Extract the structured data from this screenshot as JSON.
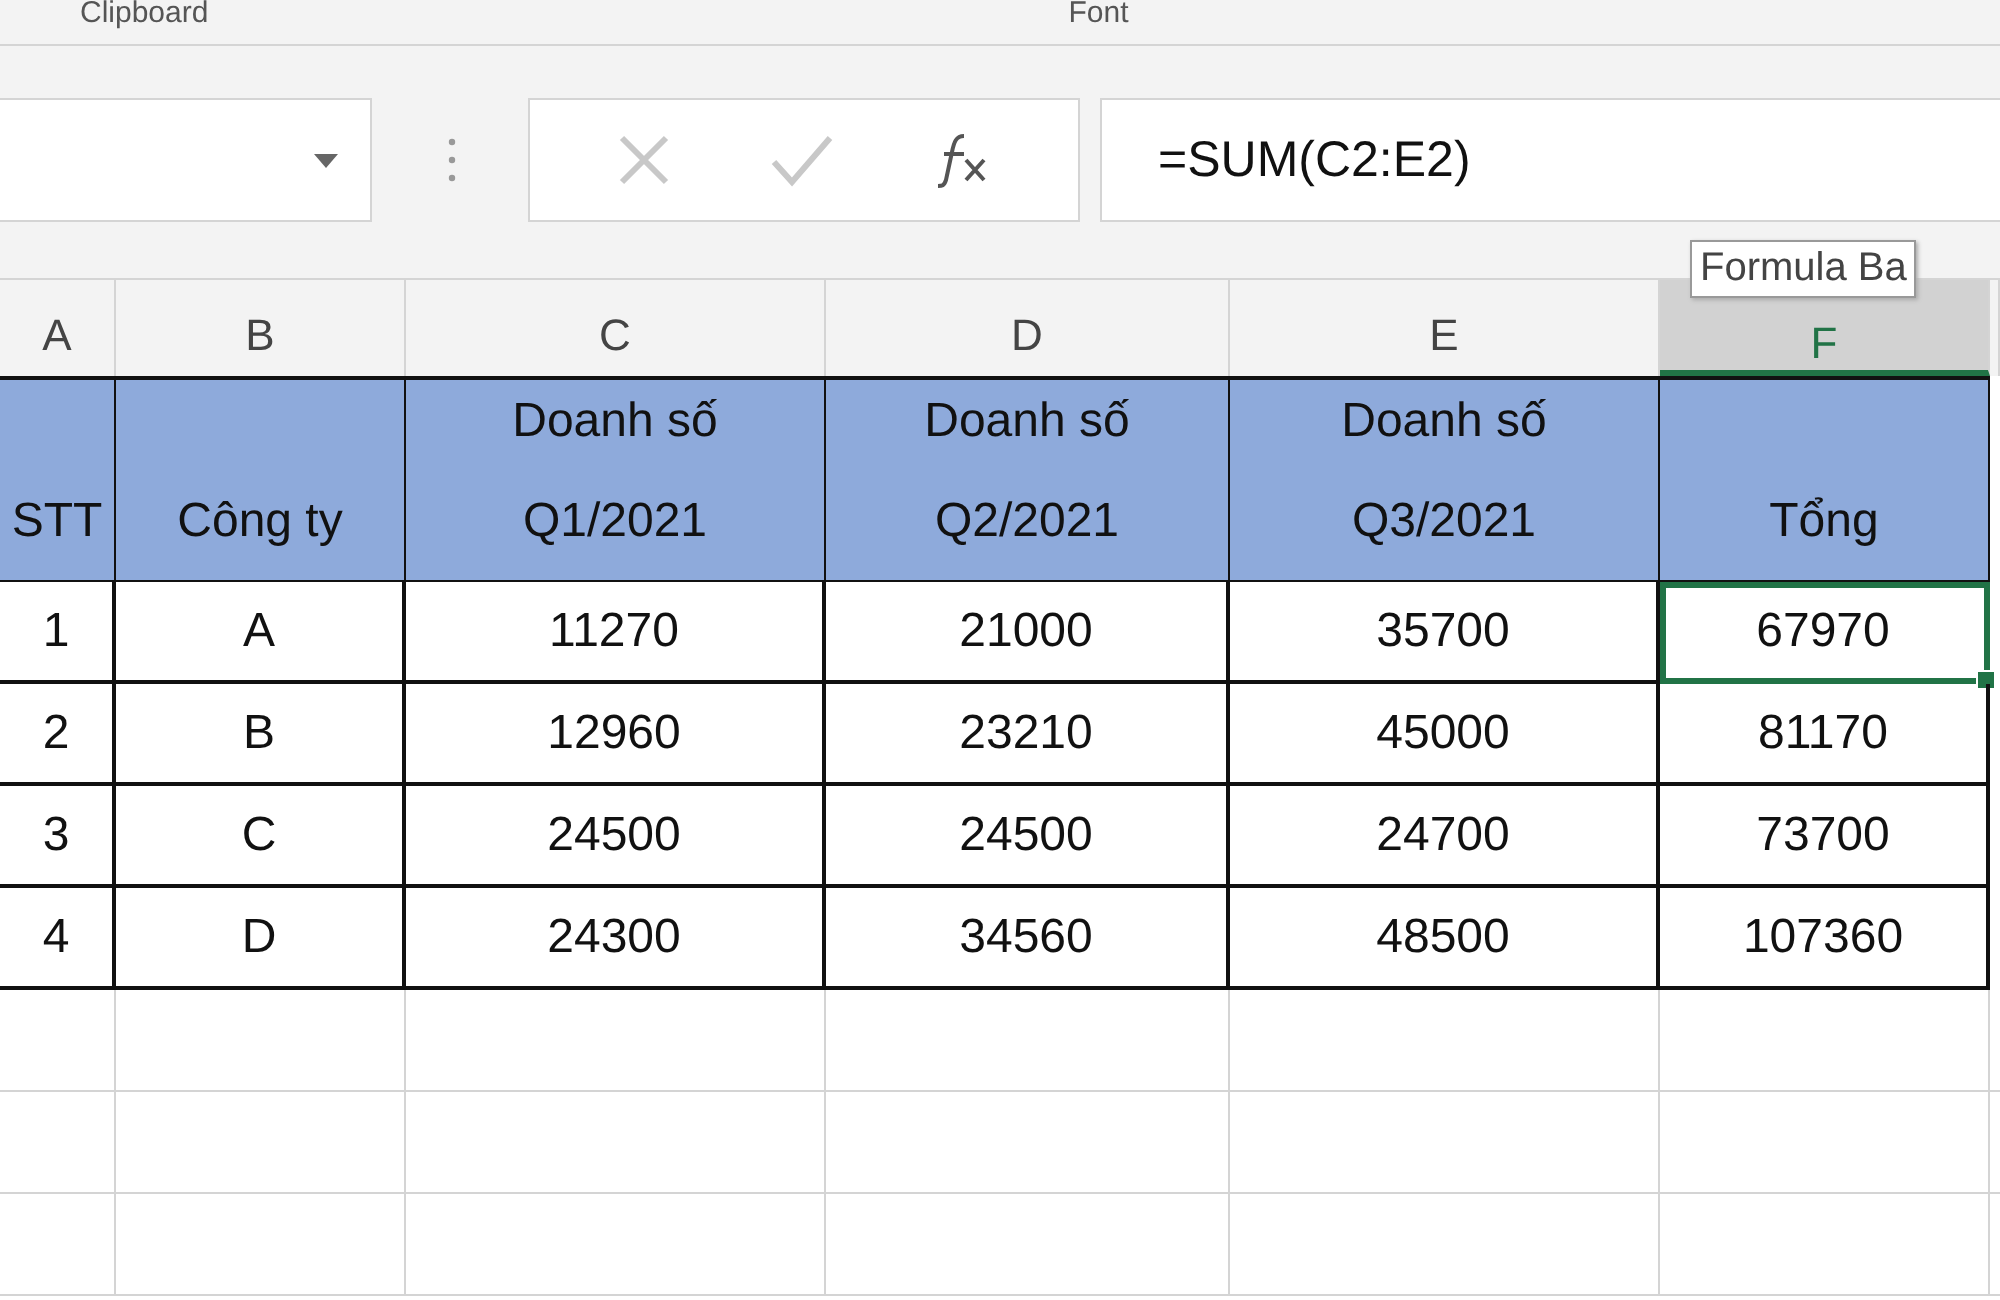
{
  "ribbon": {
    "groups": [
      "Clipboard",
      "Font"
    ]
  },
  "formula_bar": {
    "value": "=SUM(C2:E2)",
    "tooltip": "Formula Ba"
  },
  "columns": [
    {
      "label": "A",
      "selected": false
    },
    {
      "label": "B",
      "selected": false
    },
    {
      "label": "C",
      "selected": false
    },
    {
      "label": "D",
      "selected": false
    },
    {
      "label": "E",
      "selected": false
    },
    {
      "label": "F",
      "selected": true
    }
  ],
  "rows": [
    {
      "kind": "header",
      "cells": [
        {
          "text": "STT",
          "selected": false
        },
        {
          "text": "Công ty",
          "selected": false
        },
        {
          "text": "Doanh số Q1/2021",
          "selected": false
        },
        {
          "text": "Doanh số Q2/2021",
          "selected": false
        },
        {
          "text": "Doanh số Q3/2021",
          "selected": false
        },
        {
          "text": "Tổng",
          "selected": false
        }
      ]
    },
    {
      "kind": "data",
      "cells": [
        {
          "text": "1",
          "selected": false
        },
        {
          "text": "A",
          "selected": false
        },
        {
          "text": "11270",
          "selected": false
        },
        {
          "text": "21000",
          "selected": false
        },
        {
          "text": "35700",
          "selected": false
        },
        {
          "text": "67970",
          "selected": true
        }
      ]
    },
    {
      "kind": "data",
      "cells": [
        {
          "text": "2",
          "selected": false
        },
        {
          "text": "B",
          "selected": false
        },
        {
          "text": "12960",
          "selected": false
        },
        {
          "text": "23210",
          "selected": false
        },
        {
          "text": "45000",
          "selected": false
        },
        {
          "text": "81170",
          "selected": false
        }
      ]
    },
    {
      "kind": "data",
      "cells": [
        {
          "text": "3",
          "selected": false
        },
        {
          "text": "C",
          "selected": false
        },
        {
          "text": "24500",
          "selected": false
        },
        {
          "text": "24500",
          "selected": false
        },
        {
          "text": "24700",
          "selected": false
        },
        {
          "text": "73700",
          "selected": false
        }
      ]
    },
    {
      "kind": "data",
      "cells": [
        {
          "text": "4",
          "selected": false
        },
        {
          "text": "D",
          "selected": false
        },
        {
          "text": "24300",
          "selected": false
        },
        {
          "text": "34560",
          "selected": false
        },
        {
          "text": "48500",
          "selected": false
        },
        {
          "text": "107360",
          "selected": false
        }
      ]
    }
  ]
}
